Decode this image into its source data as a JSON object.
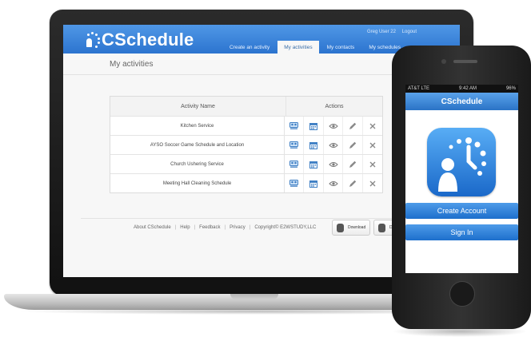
{
  "web": {
    "logo": "CSchedule",
    "user": "Greg User 22",
    "logout": "Logout",
    "nav": [
      {
        "label": "Create an activity"
      },
      {
        "label": "My activities"
      },
      {
        "label": "My contacts"
      },
      {
        "label": "My schedules"
      }
    ],
    "page_title": "My activities",
    "table": {
      "headers": {
        "name": "Activity Name",
        "actions": "Actions"
      },
      "rows": [
        {
          "name": "Kitchen Service"
        },
        {
          "name": "AYSO Soccer Game Schedule and Location"
        },
        {
          "name": "Church Ushering Service"
        },
        {
          "name": "Meeting Hall Cleaning Schedule"
        }
      ],
      "action_icons": [
        "participants-icon",
        "calendar-icon",
        "view-icon",
        "edit-icon",
        "delete-icon"
      ]
    },
    "footer": {
      "links": [
        "About CSchedule",
        "Help",
        "Feedback",
        "Privacy"
      ],
      "copyright": "Copyright© E2WSTUDY,LLC",
      "download_ios": "Download",
      "download_android": "Do"
    },
    "colors": {
      "header": "#2c74cf",
      "accent": "#4a8ed8"
    }
  },
  "phone": {
    "carrier": "AT&T LTE",
    "time": "9:42 AM",
    "battery": "96%",
    "title": "CSchedule",
    "create_account": "Create Account",
    "sign_in": "Sign In"
  }
}
